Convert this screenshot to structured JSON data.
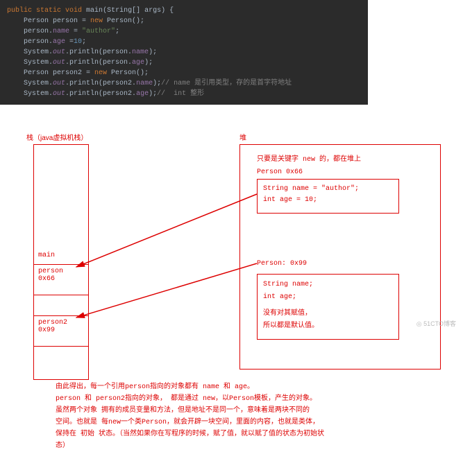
{
  "code": {
    "l1": "public static void main(String[] args) {",
    "l2": "    Person person = new Person();",
    "l3": "    person.name = \"author\";",
    "l4": "    person.age =10;",
    "l5": "    System.out.println(person.name);",
    "l6": "    System.out.println(person.age);",
    "l7": "    Person person2 = new Person();",
    "l8a": "    System.out.println(person2.name);",
    "l8b": "// name 是引用类型，存的是首字符地址",
    "l9a": "    System.out.println(person2.age);",
    "l9b": "//  int 整形"
  },
  "diagram": {
    "stackTitle": "栈（java虚拟机栈）",
    "heapTitle": "堆",
    "heapNote": "只要是关键字 new 的，都在堆上",
    "stack": {
      "mainLabel": "main",
      "cell1": {
        "var": "person",
        "addr": "0x66"
      },
      "cell2": {
        "var": "person2",
        "addr": "0x99"
      }
    },
    "heap": {
      "obj1": {
        "label": "Person 0x66",
        "line1": "String name = \"author\";",
        "line2": "int age = 10;"
      },
      "obj2": {
        "label": "Person: 0x99",
        "line1": "String name;",
        "line2": "int age;",
        "note1": "没有对其赋值，",
        "note2": "所以都是默认值。"
      }
    },
    "bottom": {
      "l1": "由此得出，每一个引用person指向的对象都有 name 和 age。",
      "l2": "person 和 person2指向的对象， 都是通过 new，以Person模板，产生的对象。",
      "l3": "虽然两个对象 拥有的成员变量和方法，但是地址不是同一个，意味着是两块不同的",
      "l4": "空间。也就是 每new一个类Person，就会开辟一块空间，里面的内容，也就是类体，",
      "l5": "保持在 初始  状态。（当然如果你在写程序的时候，赋了值，就以赋了值的状态为初始状",
      "l6": "态）"
    }
  },
  "watermark": "◎ 51CTO博客"
}
